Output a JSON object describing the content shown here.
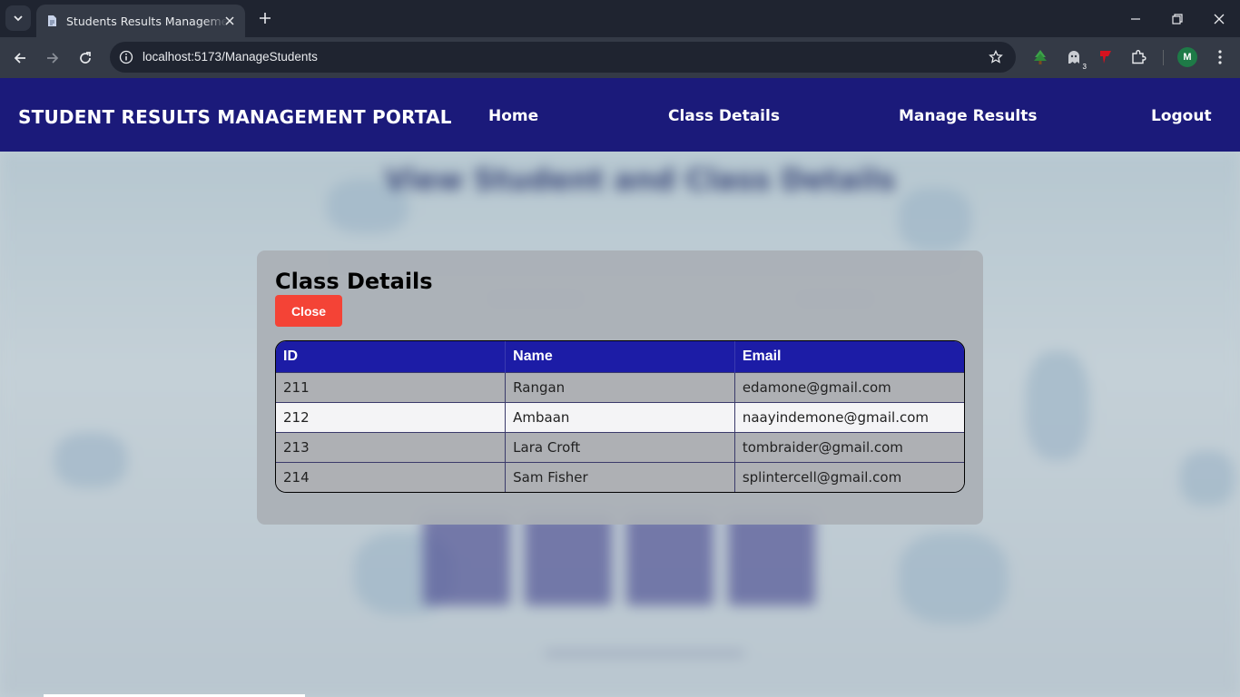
{
  "browser": {
    "tab_title": "Students Results Management Portal",
    "url": "localhost:5173/ManageStudents",
    "extension_badge": "3",
    "profile_initial": "M"
  },
  "navbar": {
    "brand": "STUDENT RESULTS MANAGEMENT PORTAL",
    "links": [
      "Home",
      "Class Details",
      "Manage Results",
      "Logout"
    ]
  },
  "background": {
    "heading": "View Student and Class Details"
  },
  "modal": {
    "title": "Class Details",
    "close_label": "Close",
    "columns": [
      "ID",
      "Name",
      "Email"
    ],
    "rows": [
      {
        "id": "211",
        "name": "Rangan",
        "email": "edamone@gmail.com"
      },
      {
        "id": "212",
        "name": "Ambaan",
        "email": "naayindemone@gmail.com"
      },
      {
        "id": "213",
        "name": "Lara Croft",
        "email": "tombraider@gmail.com"
      },
      {
        "id": "214",
        "name": "Sam Fisher",
        "email": "splintercell@gmail.com"
      }
    ]
  },
  "colors": {
    "navbar_bg": "#1b1a7a",
    "table_header_bg": "#1c1ca6",
    "close_button_bg": "#f44336"
  }
}
